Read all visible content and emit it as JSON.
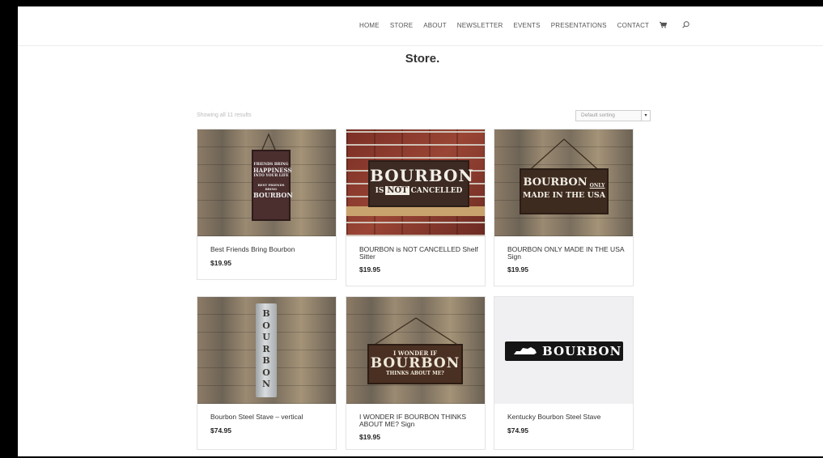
{
  "nav": {
    "items": [
      "HOME",
      "STORE",
      "ABOUT",
      "NEWSLETTER",
      "EVENTS",
      "PRESENTATIONS",
      "CONTACT"
    ],
    "cart_icon": "cart-icon",
    "search_icon": "search-icon"
  },
  "page": {
    "title": "Store.",
    "result_count": "Showing all 11 results",
    "sorting": "Default sorting"
  },
  "products": [
    {
      "name": "Best Friends Bring Bourbon",
      "price": "$19.95",
      "sign_lines": [
        "FRIENDS BRING",
        "HAPPINESS",
        "INTO YOUR LIFE",
        "BEST FRIENDS BRING",
        "BOURBON"
      ]
    },
    {
      "name": "BOURBON is NOT CANCELLED Shelf Sitter",
      "price": "$19.95",
      "sign_lines": [
        "BOURBON",
        "IS",
        "NOT",
        "CANCELLED"
      ]
    },
    {
      "name": "BOURBON ONLY MADE IN THE USA Sign",
      "price": "$19.95",
      "sign_lines": [
        "BOURBON",
        "ONLY",
        "MADE IN THE USA"
      ]
    },
    {
      "name": "Bourbon Steel Stave – vertical",
      "price": "$74.95",
      "sign_lines": [
        "B",
        "O",
        "U",
        "R",
        "B",
        "O",
        "N"
      ]
    },
    {
      "name": "I WONDER IF BOURBON THINKS ABOUT ME? Sign",
      "price": "$19.95",
      "sign_lines": [
        "I WONDER IF",
        "BOURBON",
        "THINKS ABOUT ME?"
      ]
    },
    {
      "name": "Kentucky Bourbon Steel Stave",
      "price": "$74.95",
      "sign_lines": [
        "BOURBON"
      ]
    }
  ]
}
